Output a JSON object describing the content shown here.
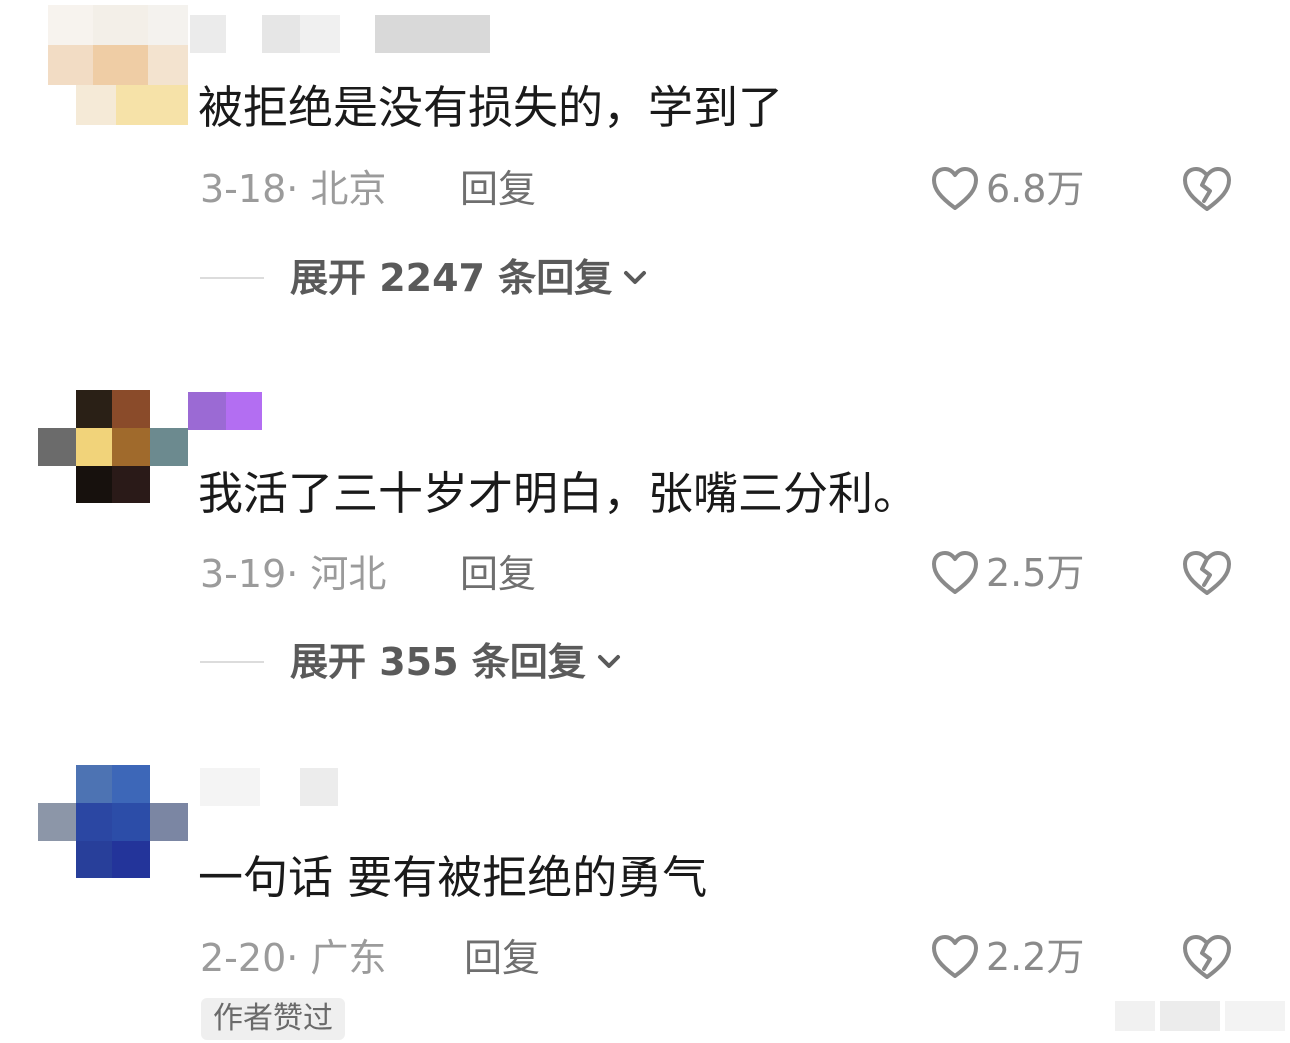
{
  "comments": [
    {
      "text": "被拒绝是没有损失的，学到了",
      "date_location": "3-18· 北京",
      "reply_label": "回复",
      "like_count": "6.8万",
      "expand_label": "展开 2247 条回复"
    },
    {
      "text": "我活了三十岁才明白，张嘴三分利。",
      "date_location": "3-19· 河北",
      "reply_label": "回复",
      "like_count": "2.5万",
      "expand_label": "展开 355 条回复"
    },
    {
      "text": "一句话 要有被拒绝的勇气",
      "date_location": "2-20· 广东",
      "reply_label": "回复",
      "like_count": "2.2万",
      "badge": "作者赞过"
    }
  ],
  "icons": {
    "like": "heart-outline-icon",
    "dislike": "broken-heart-icon",
    "expand": "chevron-down-icon"
  },
  "colors": {
    "text": "#1a1a1a",
    "meta": "#9b9b9b",
    "icon": "#8a8a8a",
    "badge_bg": "#efefef"
  }
}
